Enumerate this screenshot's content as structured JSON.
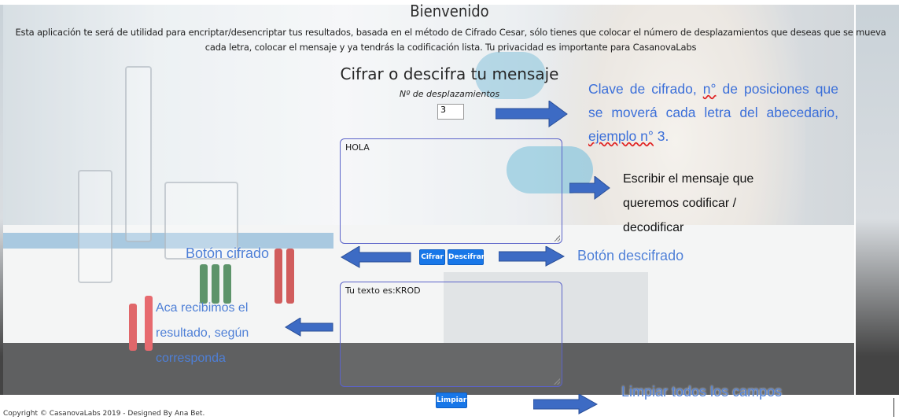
{
  "header": {
    "title": "Bienvenido",
    "intro": "Esta aplicación te será de utilidad para encriptar/desencriptar tus resultados, basada en el método de Cifrado Cesar, sólo tienes que colocar el número de desplazamientos que deseas que se mueva cada letra, colocar el mensaje y ya tendrás la codificación lista. Tu privacidad es importante para CasanovaLabs"
  },
  "form": {
    "subtitle": "Cifrar o descifra tu mensaje",
    "shift_label": "Nº de desplazamientos",
    "shift_value": "3",
    "input_message": "HOLA",
    "output_message": "Tu texto es:KROD",
    "cifrar_label": "Cifrar",
    "descifrar_label": "Descifrar",
    "limpiar_label": "Limpiar"
  },
  "footer": {
    "text": "Copyright © CasanovaLabs 2019 - Designed By Ana Bet."
  },
  "annotations": {
    "clave_part1": "Clave de cifrado, ",
    "clave_sq1": "n°",
    "clave_part2": " de posiciones que se moverá cada letra del abecedario, ",
    "clave_sq2": "ejemplo n°",
    "clave_part3": " 3.",
    "escribir": "Escribir el mensaje que queremos codificar / decodificar",
    "boton_cifrado": "Botón cifrado",
    "boton_descifrado": "Botón descifrado",
    "aca": "Aca recibimos el resultado, según corresponda",
    "limpiar": "Limpiar todos los campos"
  },
  "colors": {
    "button": "#1877e8",
    "annotation_text": "#3b6fd9",
    "arrow": "#3d6bc4"
  }
}
